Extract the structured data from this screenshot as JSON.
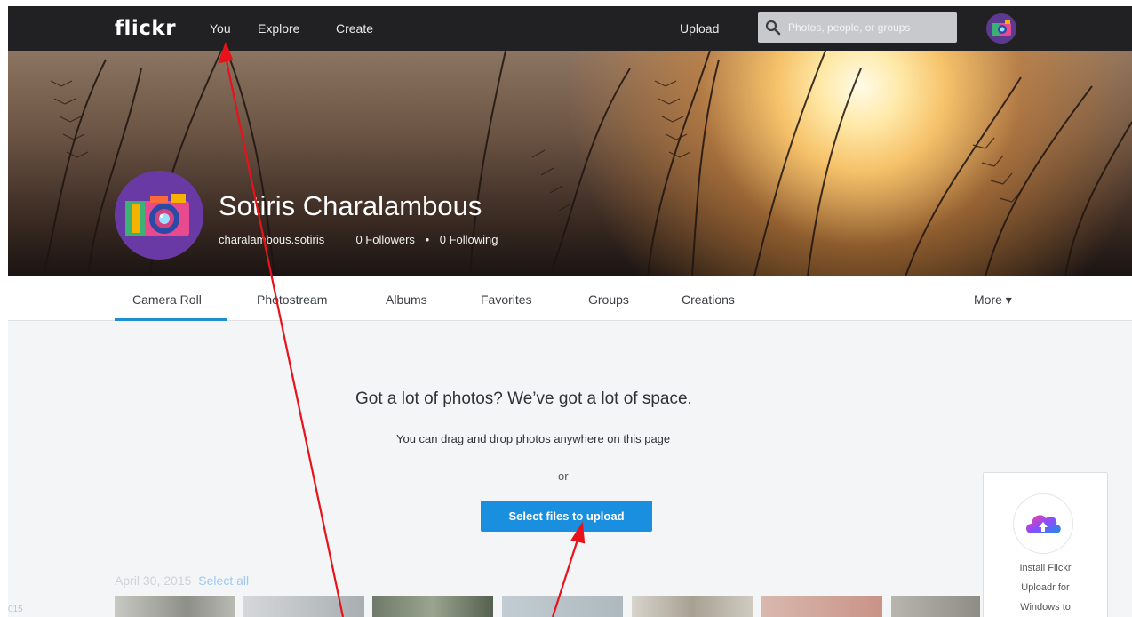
{
  "topnav": {
    "logo": "flickr",
    "links": [
      "You",
      "Explore",
      "Create"
    ],
    "upload": "Upload",
    "search_placeholder": "Photos, people, or groups"
  },
  "profile": {
    "name": "Sotiris Charalambous",
    "username": "charalambous.sotiris",
    "followers": "0 Followers",
    "separator": "•",
    "following": "0 Following"
  },
  "subnav": {
    "tabs": [
      "Camera Roll",
      "Photostream",
      "Albums",
      "Favorites",
      "Groups",
      "Creations"
    ],
    "active_tab": "Camera Roll",
    "more": "More ▾"
  },
  "main": {
    "headline": "Got a lot of photos? We’ve got a lot of space.",
    "subline": "You can drag and drop photos anywhere on this page",
    "or": "or",
    "cta": "Select files to upload",
    "date": "April 30, 2015",
    "select_all": "Select all",
    "side_num": "015"
  },
  "promo": {
    "lines": [
      "Install Flickr",
      "Uploadr for",
      "Windows to"
    ]
  },
  "colors": {
    "nav_bg": "#212124",
    "accent": "#1a8fe0",
    "tab_underline": "#1f8fd1",
    "annotation": "#e8121b"
  },
  "icons": {
    "search": "magnifier-icon",
    "avatar": "camera-avatar-icon",
    "promo": "cloud-upload-icon"
  }
}
